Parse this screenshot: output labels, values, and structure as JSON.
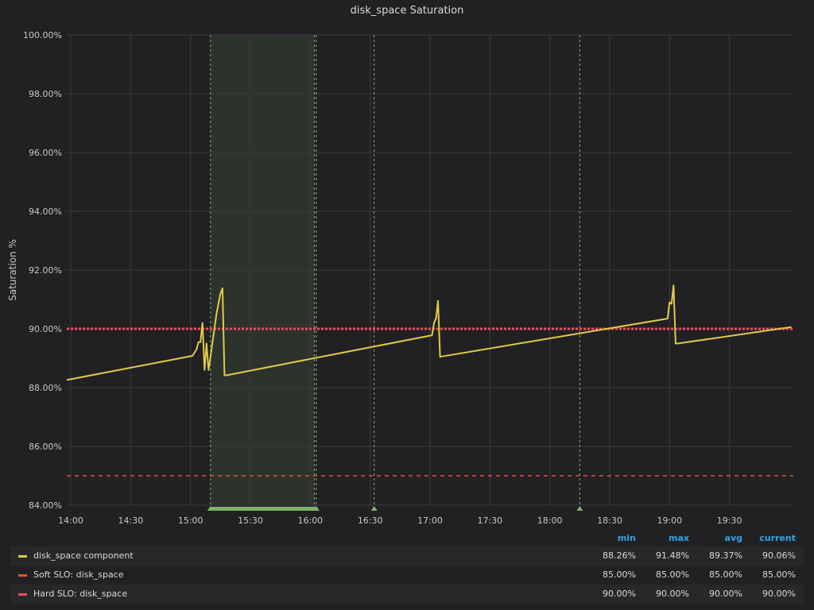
{
  "panel": {
    "title": "disk_space Saturation"
  },
  "chart_data": {
    "type": "line",
    "ylabel": "Saturation %",
    "ylim": [
      84,
      100
    ],
    "yticks": [
      "84.00%",
      "86.00%",
      "88.00%",
      "90.00%",
      "92.00%",
      "94.00%",
      "96.00%",
      "98.00%",
      "100.00%"
    ],
    "xticks": [
      "14:00",
      "14:30",
      "15:00",
      "15:30",
      "16:00",
      "16:30",
      "17:00",
      "17:30",
      "18:00",
      "18:30",
      "19:00",
      "19:30"
    ],
    "series": [
      {
        "name": "disk_space component",
        "color": "#e0cb46",
        "x": [
          "13:58",
          "15:01",
          "15:03",
          "15:04",
          "15:05",
          "15:06",
          "15:07",
          "15:08",
          "15:09",
          "15:10",
          "15:13",
          "15:15",
          "15:16",
          "15:17",
          "15:18",
          "17:01",
          "17:02",
          "17:03",
          "17:04",
          "17:05",
          "18:59",
          "19:00",
          "19:01",
          "19:02",
          "19:03",
          "19:04",
          "20:01"
        ],
        "y": [
          88.26,
          89.08,
          89.3,
          89.55,
          89.55,
          90.2,
          88.6,
          89.5,
          88.6,
          89.05,
          90.5,
          91.2,
          91.38,
          88.42,
          88.42,
          89.78,
          90.2,
          90.35,
          90.95,
          89.05,
          90.35,
          90.9,
          90.85,
          91.48,
          89.5,
          89.5,
          90.06
        ]
      },
      {
        "name": "Soft SLO: disk_space",
        "color": "#e0571f",
        "dash": "dashed",
        "value": 85.0
      },
      {
        "name": "Hard SLO: disk_space",
        "color": "#f2495c",
        "dash": "dotted",
        "value": 90.0
      }
    ],
    "annotations": {
      "markers": [
        "15:10",
        "16:02",
        "16:03",
        "16:32",
        "18:15"
      ],
      "region": [
        "15:10",
        "16:02"
      ],
      "color": "#7eb26d"
    }
  },
  "legend": {
    "columns": [
      "min",
      "max",
      "avg",
      "current"
    ],
    "rows": [
      {
        "name": "disk_space component",
        "color": "#e0cb46",
        "min": "88.26%",
        "max": "91.48%",
        "avg": "89.37%",
        "current": "90.06%"
      },
      {
        "name": "Soft SLO: disk_space",
        "color": "#e0571f",
        "min": "85.00%",
        "max": "85.00%",
        "avg": "85.00%",
        "current": "85.00%"
      },
      {
        "name": "Hard SLO: disk_space",
        "color": "#f2495c",
        "min": "90.00%",
        "max": "90.00%",
        "avg": "90.00%",
        "current": "90.00%"
      }
    ]
  }
}
